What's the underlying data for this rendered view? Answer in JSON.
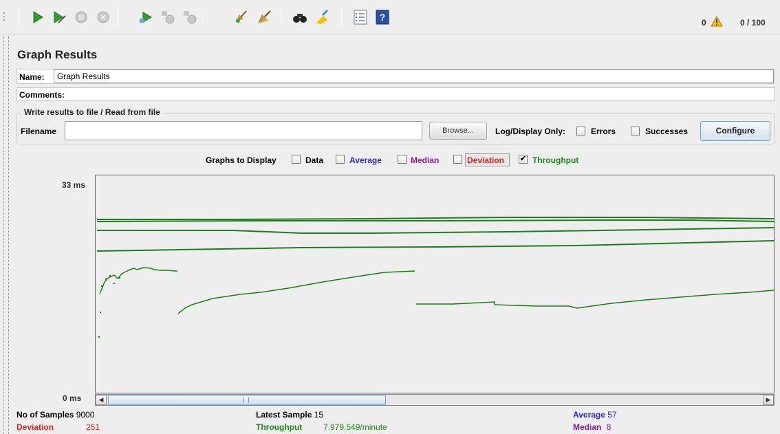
{
  "toolbar": {
    "buttons": [
      "start-icon",
      "start-no-pauses-icon",
      "stop-icon",
      "shutdown-icon",
      "remote-start-icon",
      "remote-stop-icon",
      "remote-shutdown-icon",
      "clear-icon",
      "clear-all-icon",
      "search-icon",
      "reset-search-icon",
      "function-helper-icon",
      "help-icon"
    ],
    "error_count": "0",
    "threads_ratio": "0 / 100"
  },
  "panel": {
    "title": "Graph Results",
    "name_label": "Name:",
    "name_value": "Graph Results",
    "comments_label": "Comments:",
    "comments_value": ""
  },
  "file_group": {
    "title": "Write results to file / Read from file",
    "filename_label": "Filename",
    "filename_value": "",
    "browse_label": "Browse...",
    "log_display_label": "Log/Display Only:",
    "errors_label": "Errors",
    "errors_checked": false,
    "successes_label": "Successes",
    "successes_checked": false,
    "configure_label": "Configure"
  },
  "graphs_to_display": {
    "label": "Graphs to Display",
    "options": [
      {
        "label": "Data",
        "checked": false,
        "color": "#000000"
      },
      {
        "label": "Average",
        "checked": false,
        "color": "#2a2ad0"
      },
      {
        "label": "Median",
        "checked": false,
        "color": "#8b1a9b"
      },
      {
        "label": "Deviation",
        "checked": false,
        "color": "#e02020"
      },
      {
        "label": "Throughput",
        "checked": true,
        "color": "#1a8a1a"
      }
    ]
  },
  "chart": {
    "y_max_label": "33 ms",
    "y_min_label": "0 ms"
  },
  "stats": {
    "samples_label": "No of Samples",
    "samples_value": "9000",
    "deviation_label": "Deviation",
    "deviation_value": "251",
    "latest_label": "Latest Sample",
    "latest_value": "15",
    "throughput_label": "Throughput",
    "throughput_value": "7.979,549/minute",
    "average_label": "Average",
    "average_value": "57",
    "median_label": "Median",
    "median_value": "8"
  },
  "colors": {
    "throughput": "#1a7f1a",
    "average": "#2a2ad0",
    "median": "#8b1a9b",
    "deviation": "#e02020"
  }
}
